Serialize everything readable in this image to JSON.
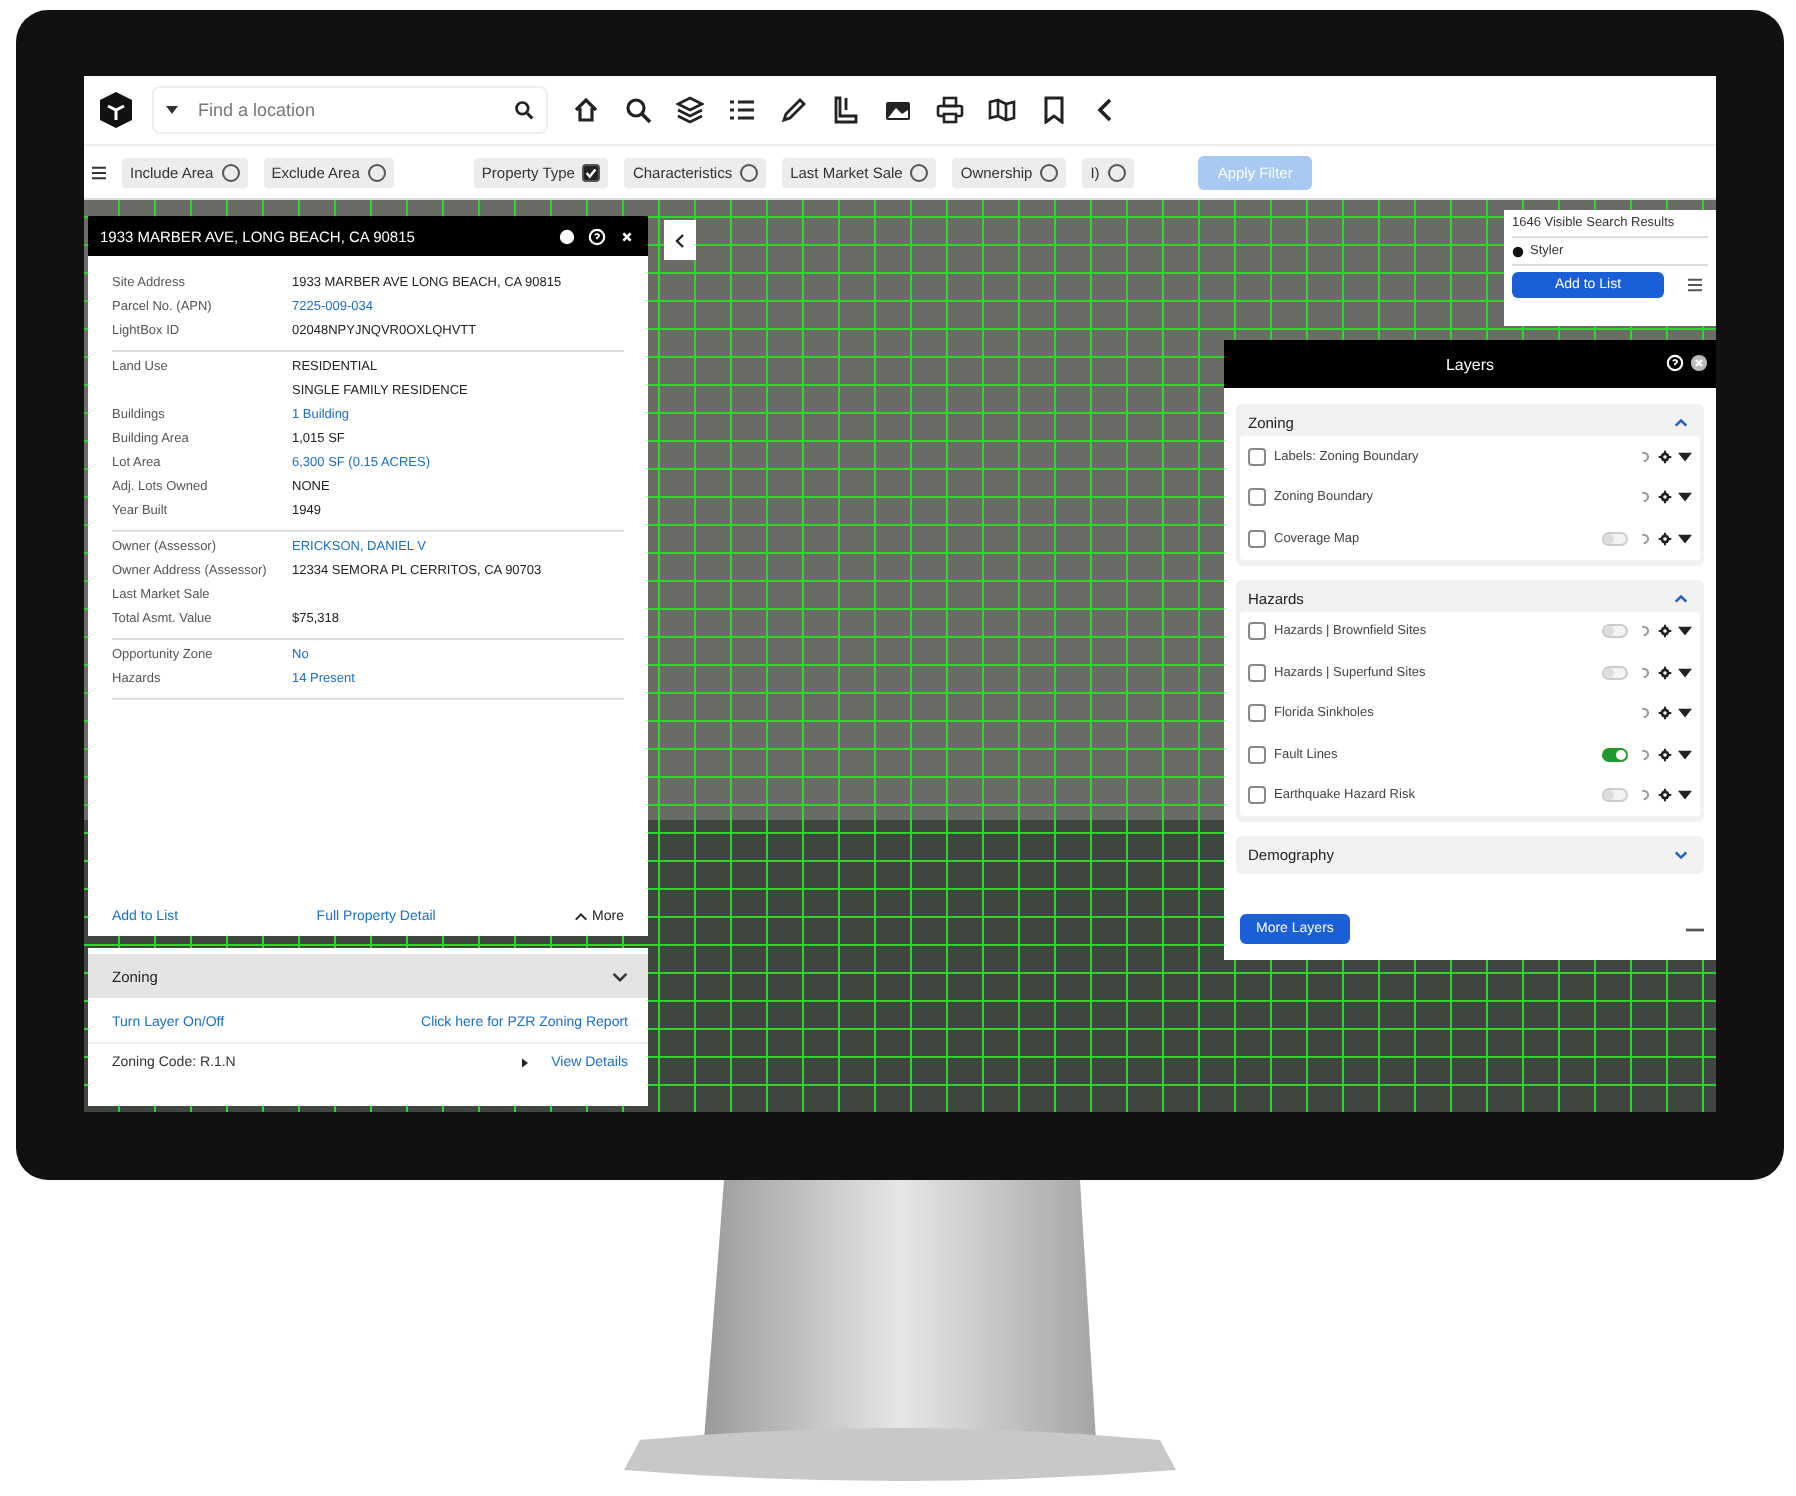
{
  "toolbar": {
    "location_placeholder": "Find a location"
  },
  "filters": {
    "chips": [
      {
        "label": "Include Area",
        "checked": false
      },
      {
        "label": "Exclude Area",
        "checked": false
      },
      {
        "label": "Property Type",
        "checked": true
      },
      {
        "label": "Characteristics",
        "checked": false
      },
      {
        "label": "Last Market Sale",
        "checked": false
      },
      {
        "label": "Ownership",
        "checked": false
      },
      {
        "label": "I)",
        "checked": false
      }
    ],
    "apply_button": {
      "label": "Apply Filter",
      "disabled": true
    }
  },
  "property_card": {
    "title": "1933 MARBER AVE, LONG BEACH, CA 90815",
    "groups": [
      {
        "rows": [
          {
            "label": "Site Address",
            "values": [
              "1933 MARBER AVE LONG BEACH, CA 90815"
            ],
            "kind": "text"
          },
          {
            "label": "Parcel No. (APN)",
            "values": [
              "7225-009-034"
            ],
            "kind": "link"
          },
          {
            "label": "LightBox ID",
            "values": [
              "02048NPYJNQVR0OXLQHVTT"
            ],
            "kind": "text"
          }
        ]
      },
      {
        "rows": [
          {
            "label": "Land Use",
            "values": [
              "RESIDENTIAL",
              "SINGLE FAMILY RESIDENCE"
            ],
            "kind": "text"
          },
          {
            "label": "Buildings",
            "values": [
              "1 Building"
            ],
            "kind": "link"
          },
          {
            "label": "Building Area",
            "values": [
              "1,015 SF"
            ],
            "kind": "text"
          },
          {
            "label": "Lot Area",
            "values": [
              "6,300 SF (0.15 ACRES)"
            ],
            "kind": "link"
          },
          {
            "label": "Adj. Lots Owned",
            "values": [
              "NONE"
            ],
            "kind": "text"
          },
          {
            "label": "Year Built",
            "values": [
              "1949"
            ],
            "kind": "text"
          }
        ]
      },
      {
        "rows": [
          {
            "label": "Owner (Assessor)",
            "values": [
              "ERICKSON, DANIEL V"
            ],
            "kind": "link"
          },
          {
            "label": "Owner Address (Assessor)",
            "values": [
              "12334 SEMORA PL CERRITOS, CA 90703"
            ],
            "kind": "text"
          },
          {
            "label": "Last Market Sale"
          },
          {
            "label": "Total Asmt. Value",
            "values": [
              "$75,318"
            ],
            "kind": "text"
          }
        ]
      },
      {
        "rows": [
          {
            "label": "Opportunity Zone",
            "values": [
              "No"
            ],
            "kind": "link"
          },
          {
            "label": "Hazards",
            "values": [
              "14 Present"
            ],
            "kind": "link"
          }
        ]
      }
    ],
    "actions": [
      "Add to List",
      "Full Property Detail"
    ],
    "more": "More"
  },
  "zoning_card": {
    "title": "Zoning",
    "links": [
      "Turn Layer On/Off",
      "Click here for PZR Zoning Report"
    ],
    "code": "Zoning Code: R.1.N",
    "details": "View Details"
  },
  "results": {
    "count": "1646 Visible Search Results",
    "styler": "Styler",
    "add_button": "Add to List"
  },
  "layers": {
    "title": "Layers",
    "sections": [
      {
        "title": "Zoning",
        "expanded": true,
        "items": [
          {
            "name": "Labels: Zoning Boundary",
            "checked": false,
            "kind": "plain"
          },
          {
            "name": "Zoning Boundary",
            "checked": false,
            "kind": "plain"
          },
          {
            "name": "Coverage Map",
            "checked": false,
            "kind": "toggle",
            "on": false
          }
        ]
      },
      {
        "title": "Hazards",
        "expanded": true,
        "items": [
          {
            "name": "Hazards | Brownfield Sites",
            "checked": false,
            "kind": "toggle",
            "on": false
          },
          {
            "name": "Hazards | Superfund Sites",
            "checked": false,
            "kind": "toggle",
            "on": false
          },
          {
            "name": "Florida Sinkholes",
            "checked": false,
            "kind": "plain"
          },
          {
            "name": "Fault Lines",
            "checked": false,
            "kind": "toggle",
            "on": true
          },
          {
            "name": "Earthquake Hazard Risk",
            "checked": false,
            "kind": "toggle",
            "on": false
          }
        ]
      },
      {
        "title": "Demography",
        "expanded": false
      }
    ],
    "more_button": "More Layers"
  }
}
